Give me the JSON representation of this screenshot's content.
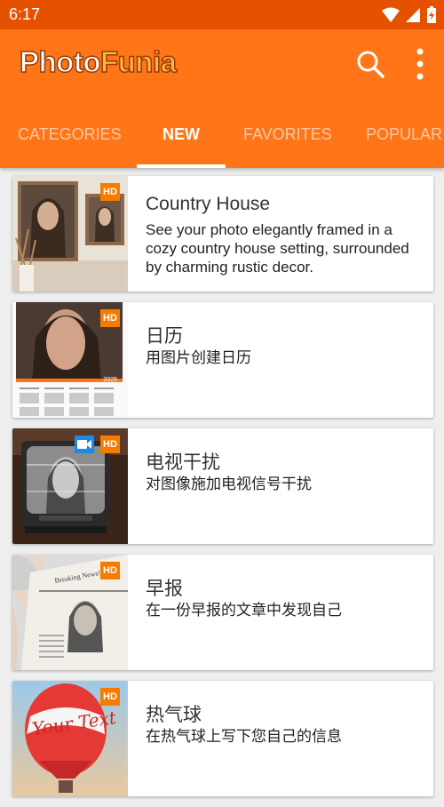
{
  "status_bar": {
    "time": "6:17"
  },
  "app_bar": {
    "logo_part1": "Photo",
    "logo_part2": "Funia",
    "search_icon": "search-icon",
    "menu_icon": "more-vert-icon"
  },
  "tabs": [
    {
      "label": "CATEGORIES",
      "active": false
    },
    {
      "label": "NEW",
      "active": true
    },
    {
      "label": "FAVORITES",
      "active": false
    },
    {
      "label": "POPULAR",
      "active": false
    }
  ],
  "effects": [
    {
      "title": "Country House",
      "description": "See your photo elegantly framed in a cozy country house setting, surrounded by charming rustic decor.",
      "badge": "HD",
      "video": false
    },
    {
      "title": "日历",
      "description": "用图片创建日历",
      "badge": "HD",
      "video": false,
      "calendar_year": "2025"
    },
    {
      "title": "电视干扰",
      "description": "对图像施加电视信号干扰",
      "badge": "HD",
      "video": true
    },
    {
      "title": "早报",
      "description": "在一份早报的文章中发现自己",
      "badge": "HD",
      "video": false,
      "newspaper_headline": "Breaking News!"
    },
    {
      "title": "热气球",
      "description": "在热气球上写下您自己的信息",
      "badge": "HD",
      "video": false,
      "balloon_text": "Your Text"
    }
  ],
  "colors": {
    "primary": "#ff7518",
    "status_bar": "#e65100",
    "badge": "#f57c00",
    "video_badge": "#1e88e5"
  }
}
